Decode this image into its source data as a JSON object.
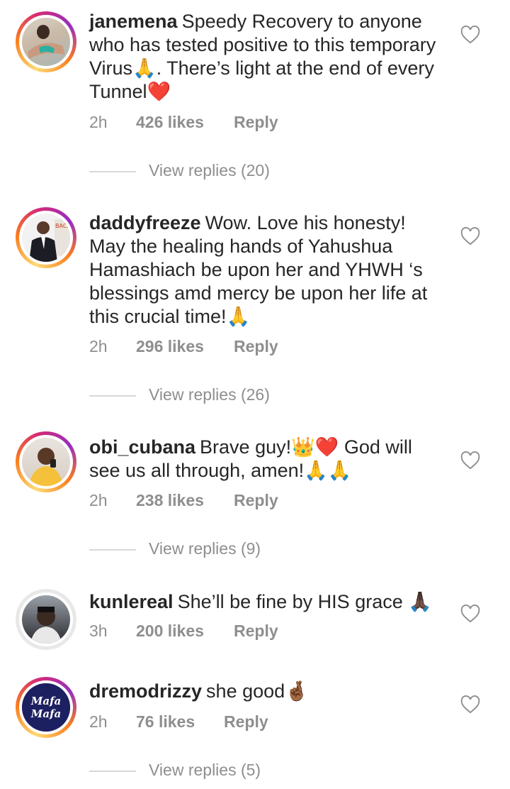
{
  "comments": [
    {
      "username": "janemena",
      "text": "Speedy Recovery to anyone who has tested positive to this temporary Virus🙏. There’s light at the end of every Tunnel❤️",
      "time": "2h",
      "likes": "426 likes",
      "reply": "Reply",
      "view_replies": "View replies (20)"
    },
    {
      "username": "daddyfreeze",
      "text": "Wow. Love his honesty! May the healing hands of Yahushua Hamashiach be upon her and YHWH ‘s blessings amd mercy be upon her life at this crucial time!🙏",
      "time": "2h",
      "likes": "296 likes",
      "reply": "Reply",
      "view_replies": "View replies (26)"
    },
    {
      "username": "obi_cubana",
      "text": "Brave guy!👑❤️ God will see us all through, amen!🙏🙏",
      "time": "2h",
      "likes": "238 likes",
      "reply": "Reply",
      "view_replies": "View replies (9)"
    },
    {
      "username": "kunlereal",
      "text": "She’ll be fine by HIS grace 🙏🏿",
      "time": "3h",
      "likes": "200 likes",
      "reply": "Reply"
    },
    {
      "username": "dremodrizzy",
      "text": "she good🤞🏾",
      "time": "2h",
      "likes": "76 likes",
      "reply": "Reply",
      "view_replies": "View replies (5)",
      "avatar_text": [
        "Mafa",
        "Mafa"
      ]
    }
  ],
  "icons": {
    "like": "heart-outline-icon"
  },
  "colors": {
    "text": "#262626",
    "secondary": "#8e8e8e",
    "divider": "#d8d8d8"
  }
}
